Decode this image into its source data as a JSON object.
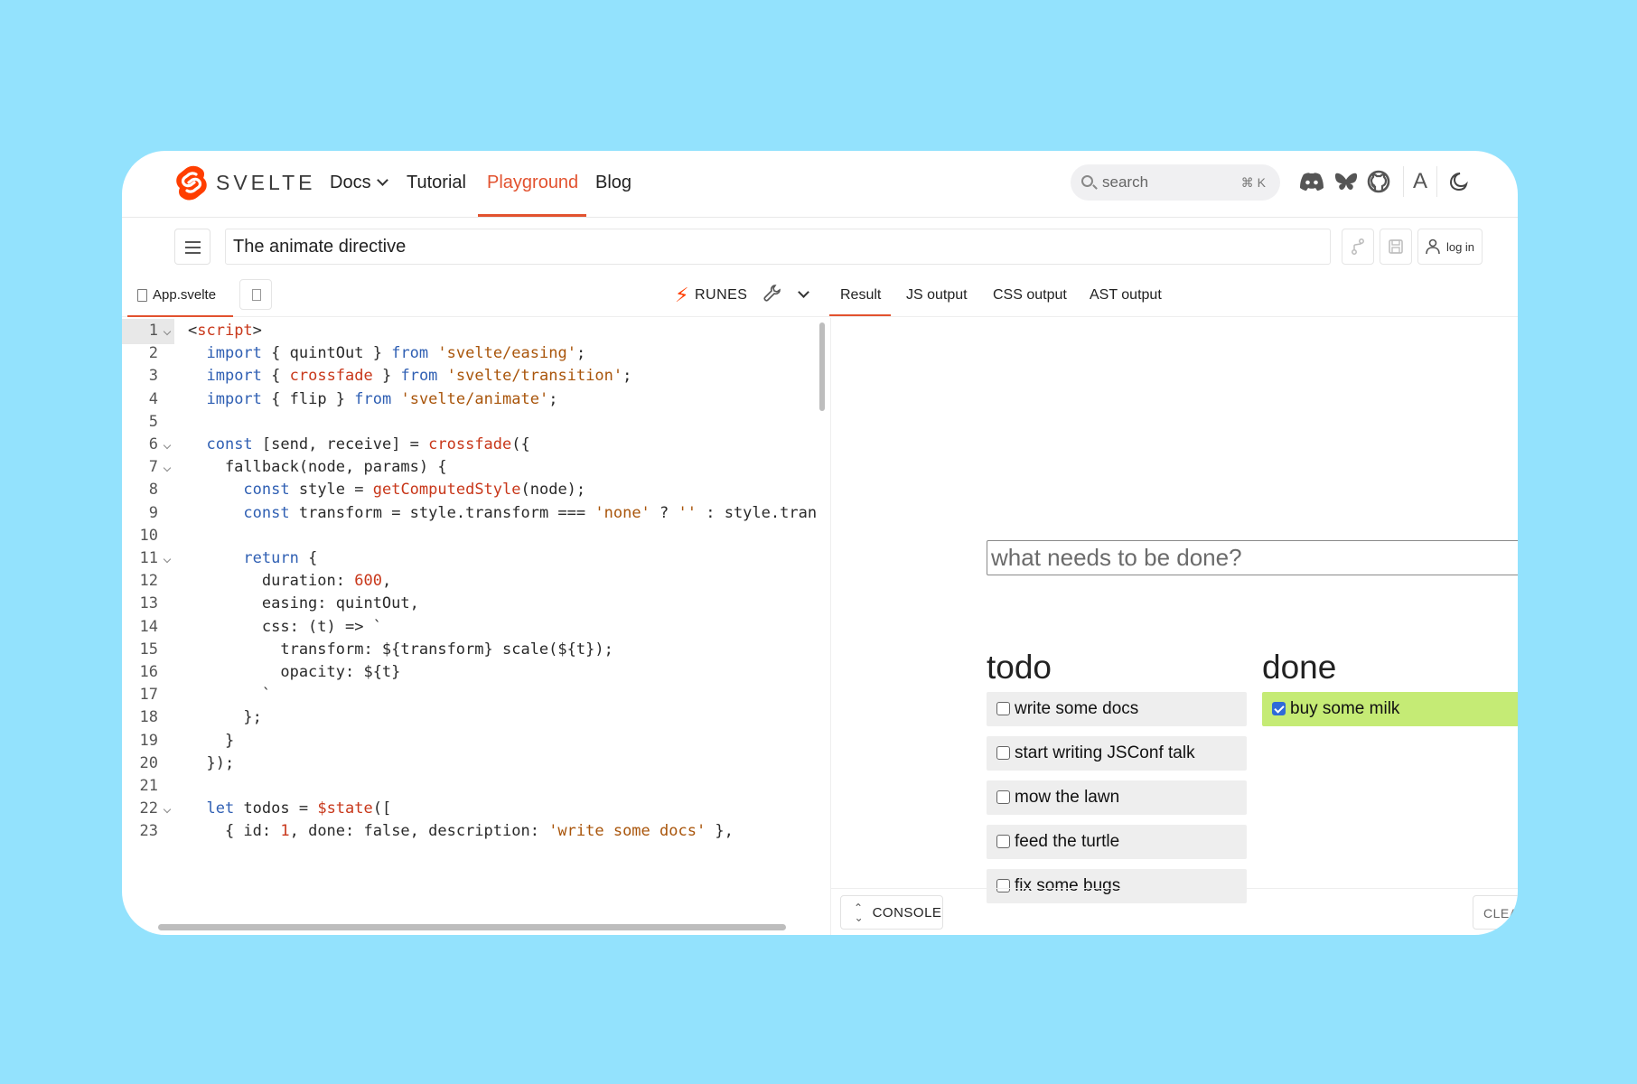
{
  "nav": {
    "brand": "SVELTE",
    "links": [
      "Docs",
      "Tutorial",
      "Playground",
      "Blog"
    ],
    "active": "Playground",
    "search_placeholder": "search",
    "search_shortcut": "⌘ K",
    "font_toggle": "A"
  },
  "title_bar": {
    "title": "The animate directive",
    "login_label": "log in"
  },
  "editor": {
    "file_tab": "App.svelte",
    "runes_label": "RUNES"
  },
  "output_tabs": [
    "Result",
    "JS output",
    "CSS output",
    "AST output"
  ],
  "code_lines": [
    "<script>",
    "  import { quintOut } from 'svelte/easing';",
    "  import { crossfade } from 'svelte/transition';",
    "  import { flip } from 'svelte/animate';",
    "",
    "  const [send, receive] = crossfade({",
    "    fallback(node, params) {",
    "      const style = getComputedStyle(node);",
    "      const transform = style.transform === 'none' ? '' : style.tran",
    "",
    "      return {",
    "        duration: 600,",
    "        easing: quintOut,",
    "        css: (t) => `",
    "          transform: ${transform} scale(${t});",
    "          opacity: ${t}",
    "        `",
    "      };",
    "    }",
    "  });",
    "",
    "  let todos = $state([",
    "    { id: 1, done: false, description: 'write some docs' },"
  ],
  "result": {
    "input_placeholder": "what needs to be done?",
    "todo_heading": "todo",
    "done_heading": "done",
    "todo_items": [
      "write some docs",
      "start writing JSConf talk",
      "mow the lawn",
      "feed the turtle",
      "fix some bugs"
    ],
    "done_items": [
      "buy some milk"
    ]
  },
  "console": {
    "label": "CONSOLE",
    "clear_label": "CLEAR"
  },
  "colors": {
    "accent": "#e2522f",
    "background": "#93e2fd",
    "done_item": "#c5eb75"
  }
}
